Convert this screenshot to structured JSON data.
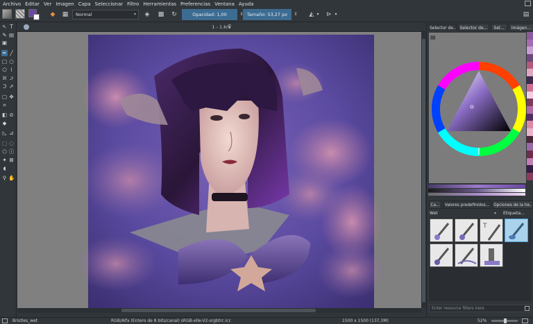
{
  "menu": [
    "Archivo",
    "Editar",
    "Ver",
    "Imagen",
    "Capa",
    "Seleccionar",
    "Filtro",
    "Herramientas",
    "Preferencias",
    "Ventana",
    "Ayuda"
  ],
  "toolbar": {
    "blend_mode": "Normal",
    "opacity_label": "Opacidad:",
    "opacity_value": "1,00",
    "size_label": "Tamaño:",
    "size_value": "53,27 px"
  },
  "document": {
    "title": "1 - 1.kra"
  },
  "right_dock": {
    "tabs": [
      "Selector de...",
      "Selector de...",
      "Sel...",
      "Imágen..."
    ],
    "preset_tabs": [
      "Ca...",
      "Valores predefinidos...",
      "Opciones de la he..."
    ],
    "preset_filter": "Wet",
    "preset_tag": "Etiqueta...",
    "filter_placeholder": "Enter resource filters here",
    "palette_colors": [
      "#8a5a9c",
      "#a56bb3",
      "#c8a0d2",
      "#6d4a7e",
      "#b35a7a",
      "#e0a7c2",
      "#3d2a4d",
      "#cf6f8f",
      "#f0d0e0",
      "#7c3d5c",
      "#ae6ba6",
      "#512d63",
      "#d98aa5",
      "#e6b5cb",
      "#4a2a3a",
      "#9a6aa8",
      "#6b2d4a",
      "#c27fb3",
      "#341d44",
      "#8b3a5e"
    ]
  },
  "status": {
    "brush_name": "Bristles_wet",
    "color_info": "RGB/Alfa (Entero de 8 bits/canal)  sRGB-elle-V2-srgbtrc.icc",
    "image_size": "1500 x 1500 (137,3M)",
    "zoom": "52%"
  },
  "colors": {
    "accent": "#3d6c92",
    "foreground": "#6b49a3",
    "background": "#ffffff"
  }
}
